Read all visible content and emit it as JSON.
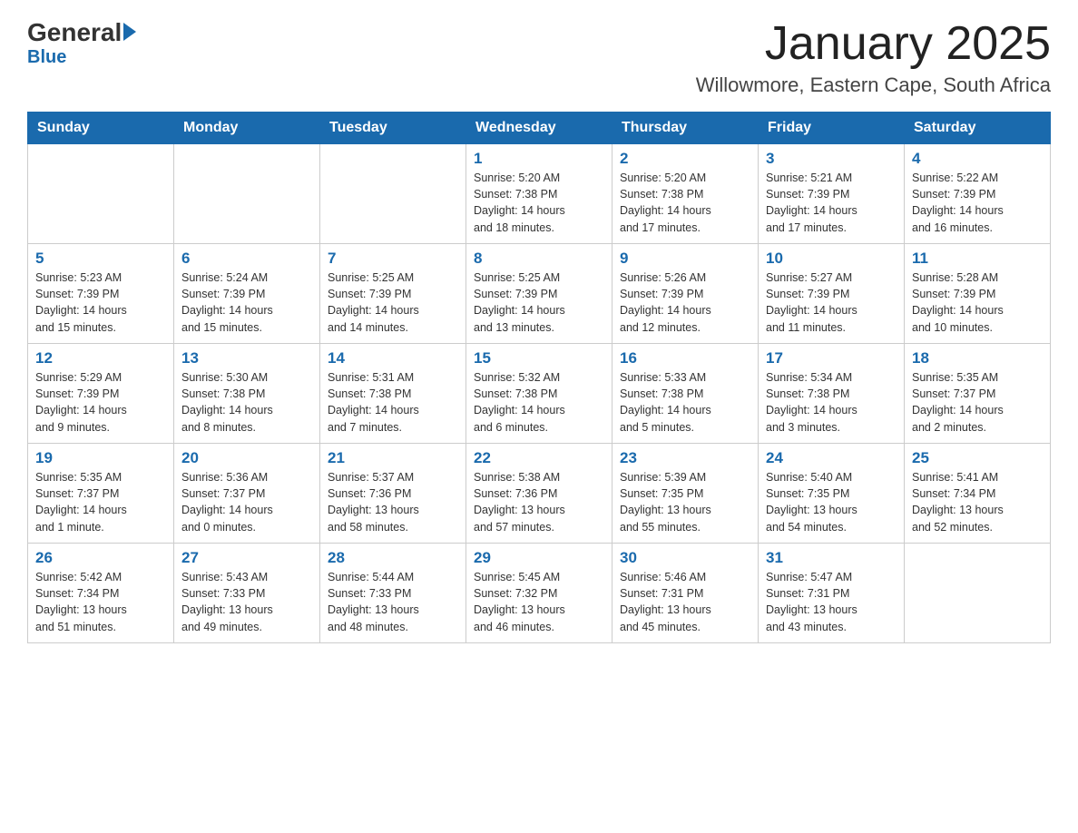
{
  "logo": {
    "general": "General",
    "blue": "Blue"
  },
  "title": "January 2025",
  "location": "Willowmore, Eastern Cape, South Africa",
  "days_of_week": [
    "Sunday",
    "Monday",
    "Tuesday",
    "Wednesday",
    "Thursday",
    "Friday",
    "Saturday"
  ],
  "weeks": [
    [
      {
        "day": "",
        "info": ""
      },
      {
        "day": "",
        "info": ""
      },
      {
        "day": "",
        "info": ""
      },
      {
        "day": "1",
        "info": "Sunrise: 5:20 AM\nSunset: 7:38 PM\nDaylight: 14 hours\nand 18 minutes."
      },
      {
        "day": "2",
        "info": "Sunrise: 5:20 AM\nSunset: 7:38 PM\nDaylight: 14 hours\nand 17 minutes."
      },
      {
        "day": "3",
        "info": "Sunrise: 5:21 AM\nSunset: 7:39 PM\nDaylight: 14 hours\nand 17 minutes."
      },
      {
        "day": "4",
        "info": "Sunrise: 5:22 AM\nSunset: 7:39 PM\nDaylight: 14 hours\nand 16 minutes."
      }
    ],
    [
      {
        "day": "5",
        "info": "Sunrise: 5:23 AM\nSunset: 7:39 PM\nDaylight: 14 hours\nand 15 minutes."
      },
      {
        "day": "6",
        "info": "Sunrise: 5:24 AM\nSunset: 7:39 PM\nDaylight: 14 hours\nand 15 minutes."
      },
      {
        "day": "7",
        "info": "Sunrise: 5:25 AM\nSunset: 7:39 PM\nDaylight: 14 hours\nand 14 minutes."
      },
      {
        "day": "8",
        "info": "Sunrise: 5:25 AM\nSunset: 7:39 PM\nDaylight: 14 hours\nand 13 minutes."
      },
      {
        "day": "9",
        "info": "Sunrise: 5:26 AM\nSunset: 7:39 PM\nDaylight: 14 hours\nand 12 minutes."
      },
      {
        "day": "10",
        "info": "Sunrise: 5:27 AM\nSunset: 7:39 PM\nDaylight: 14 hours\nand 11 minutes."
      },
      {
        "day": "11",
        "info": "Sunrise: 5:28 AM\nSunset: 7:39 PM\nDaylight: 14 hours\nand 10 minutes."
      }
    ],
    [
      {
        "day": "12",
        "info": "Sunrise: 5:29 AM\nSunset: 7:39 PM\nDaylight: 14 hours\nand 9 minutes."
      },
      {
        "day": "13",
        "info": "Sunrise: 5:30 AM\nSunset: 7:38 PM\nDaylight: 14 hours\nand 8 minutes."
      },
      {
        "day": "14",
        "info": "Sunrise: 5:31 AM\nSunset: 7:38 PM\nDaylight: 14 hours\nand 7 minutes."
      },
      {
        "day": "15",
        "info": "Sunrise: 5:32 AM\nSunset: 7:38 PM\nDaylight: 14 hours\nand 6 minutes."
      },
      {
        "day": "16",
        "info": "Sunrise: 5:33 AM\nSunset: 7:38 PM\nDaylight: 14 hours\nand 5 minutes."
      },
      {
        "day": "17",
        "info": "Sunrise: 5:34 AM\nSunset: 7:38 PM\nDaylight: 14 hours\nand 3 minutes."
      },
      {
        "day": "18",
        "info": "Sunrise: 5:35 AM\nSunset: 7:37 PM\nDaylight: 14 hours\nand 2 minutes."
      }
    ],
    [
      {
        "day": "19",
        "info": "Sunrise: 5:35 AM\nSunset: 7:37 PM\nDaylight: 14 hours\nand 1 minute."
      },
      {
        "day": "20",
        "info": "Sunrise: 5:36 AM\nSunset: 7:37 PM\nDaylight: 14 hours\nand 0 minutes."
      },
      {
        "day": "21",
        "info": "Sunrise: 5:37 AM\nSunset: 7:36 PM\nDaylight: 13 hours\nand 58 minutes."
      },
      {
        "day": "22",
        "info": "Sunrise: 5:38 AM\nSunset: 7:36 PM\nDaylight: 13 hours\nand 57 minutes."
      },
      {
        "day": "23",
        "info": "Sunrise: 5:39 AM\nSunset: 7:35 PM\nDaylight: 13 hours\nand 55 minutes."
      },
      {
        "day": "24",
        "info": "Sunrise: 5:40 AM\nSunset: 7:35 PM\nDaylight: 13 hours\nand 54 minutes."
      },
      {
        "day": "25",
        "info": "Sunrise: 5:41 AM\nSunset: 7:34 PM\nDaylight: 13 hours\nand 52 minutes."
      }
    ],
    [
      {
        "day": "26",
        "info": "Sunrise: 5:42 AM\nSunset: 7:34 PM\nDaylight: 13 hours\nand 51 minutes."
      },
      {
        "day": "27",
        "info": "Sunrise: 5:43 AM\nSunset: 7:33 PM\nDaylight: 13 hours\nand 49 minutes."
      },
      {
        "day": "28",
        "info": "Sunrise: 5:44 AM\nSunset: 7:33 PM\nDaylight: 13 hours\nand 48 minutes."
      },
      {
        "day": "29",
        "info": "Sunrise: 5:45 AM\nSunset: 7:32 PM\nDaylight: 13 hours\nand 46 minutes."
      },
      {
        "day": "30",
        "info": "Sunrise: 5:46 AM\nSunset: 7:31 PM\nDaylight: 13 hours\nand 45 minutes."
      },
      {
        "day": "31",
        "info": "Sunrise: 5:47 AM\nSunset: 7:31 PM\nDaylight: 13 hours\nand 43 minutes."
      },
      {
        "day": "",
        "info": ""
      }
    ]
  ]
}
